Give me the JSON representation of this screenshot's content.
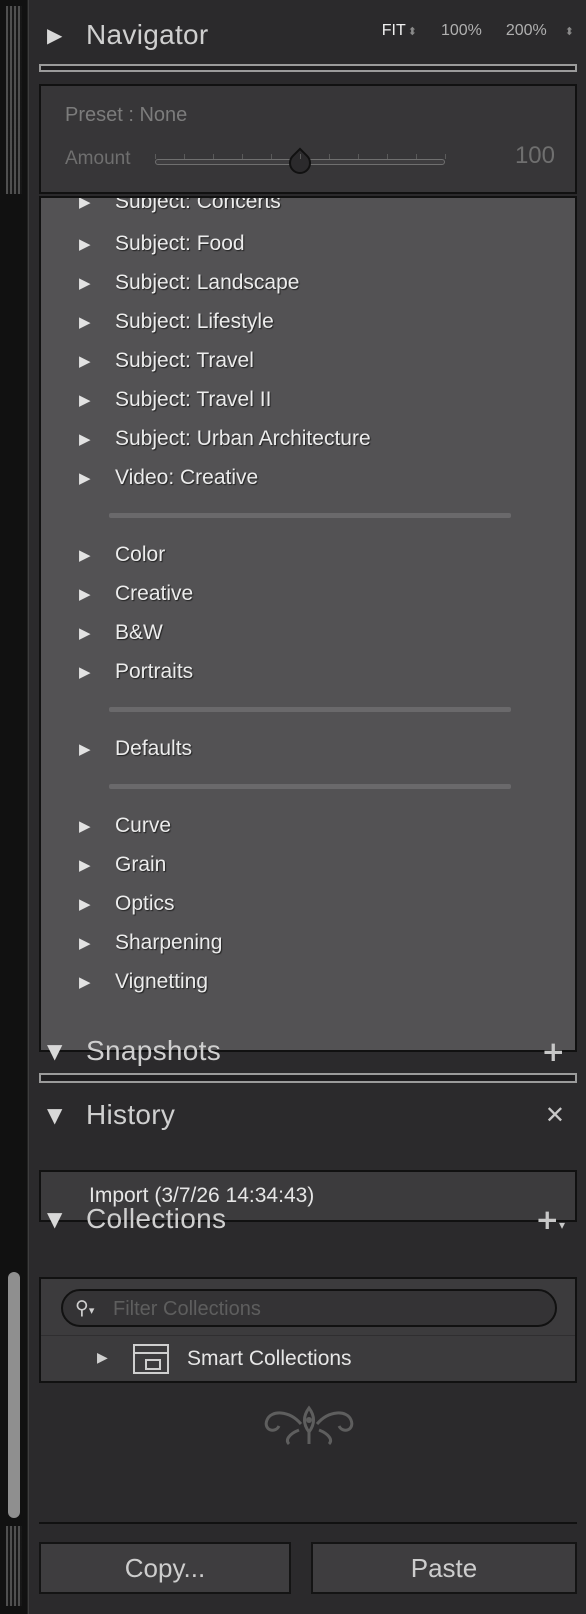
{
  "navigator": {
    "title": "Navigator",
    "zoom_options": [
      "FIT",
      "100%",
      "200%"
    ]
  },
  "preset_amount": {
    "preset_label": "Preset : None",
    "amount_label": "Amount",
    "amount_value": "100",
    "amount_fraction": 0.5
  },
  "presets": {
    "partial_item": "Subject: Concerts",
    "group1": [
      "Subject: Food",
      "Subject: Landscape",
      "Subject: Lifestyle",
      "Subject: Travel",
      "Subject: Travel II",
      "Subject: Urban Architecture",
      "Video: Creative"
    ],
    "group2": [
      "Color",
      "Creative",
      "B&W",
      "Portraits"
    ],
    "group3": [
      "Defaults"
    ],
    "group4": [
      "Curve",
      "Grain",
      "Optics",
      "Sharpening",
      "Vignetting"
    ]
  },
  "snapshots": {
    "title": "Snapshots"
  },
  "history": {
    "title": "History",
    "items": [
      "Import (3/7/26 14:34:43)"
    ]
  },
  "collections": {
    "title": "Collections",
    "filter_placeholder": "Filter Collections",
    "items": [
      "Smart Collections"
    ]
  },
  "footer": {
    "copy_label": "Copy...",
    "paste_label": "Paste"
  }
}
